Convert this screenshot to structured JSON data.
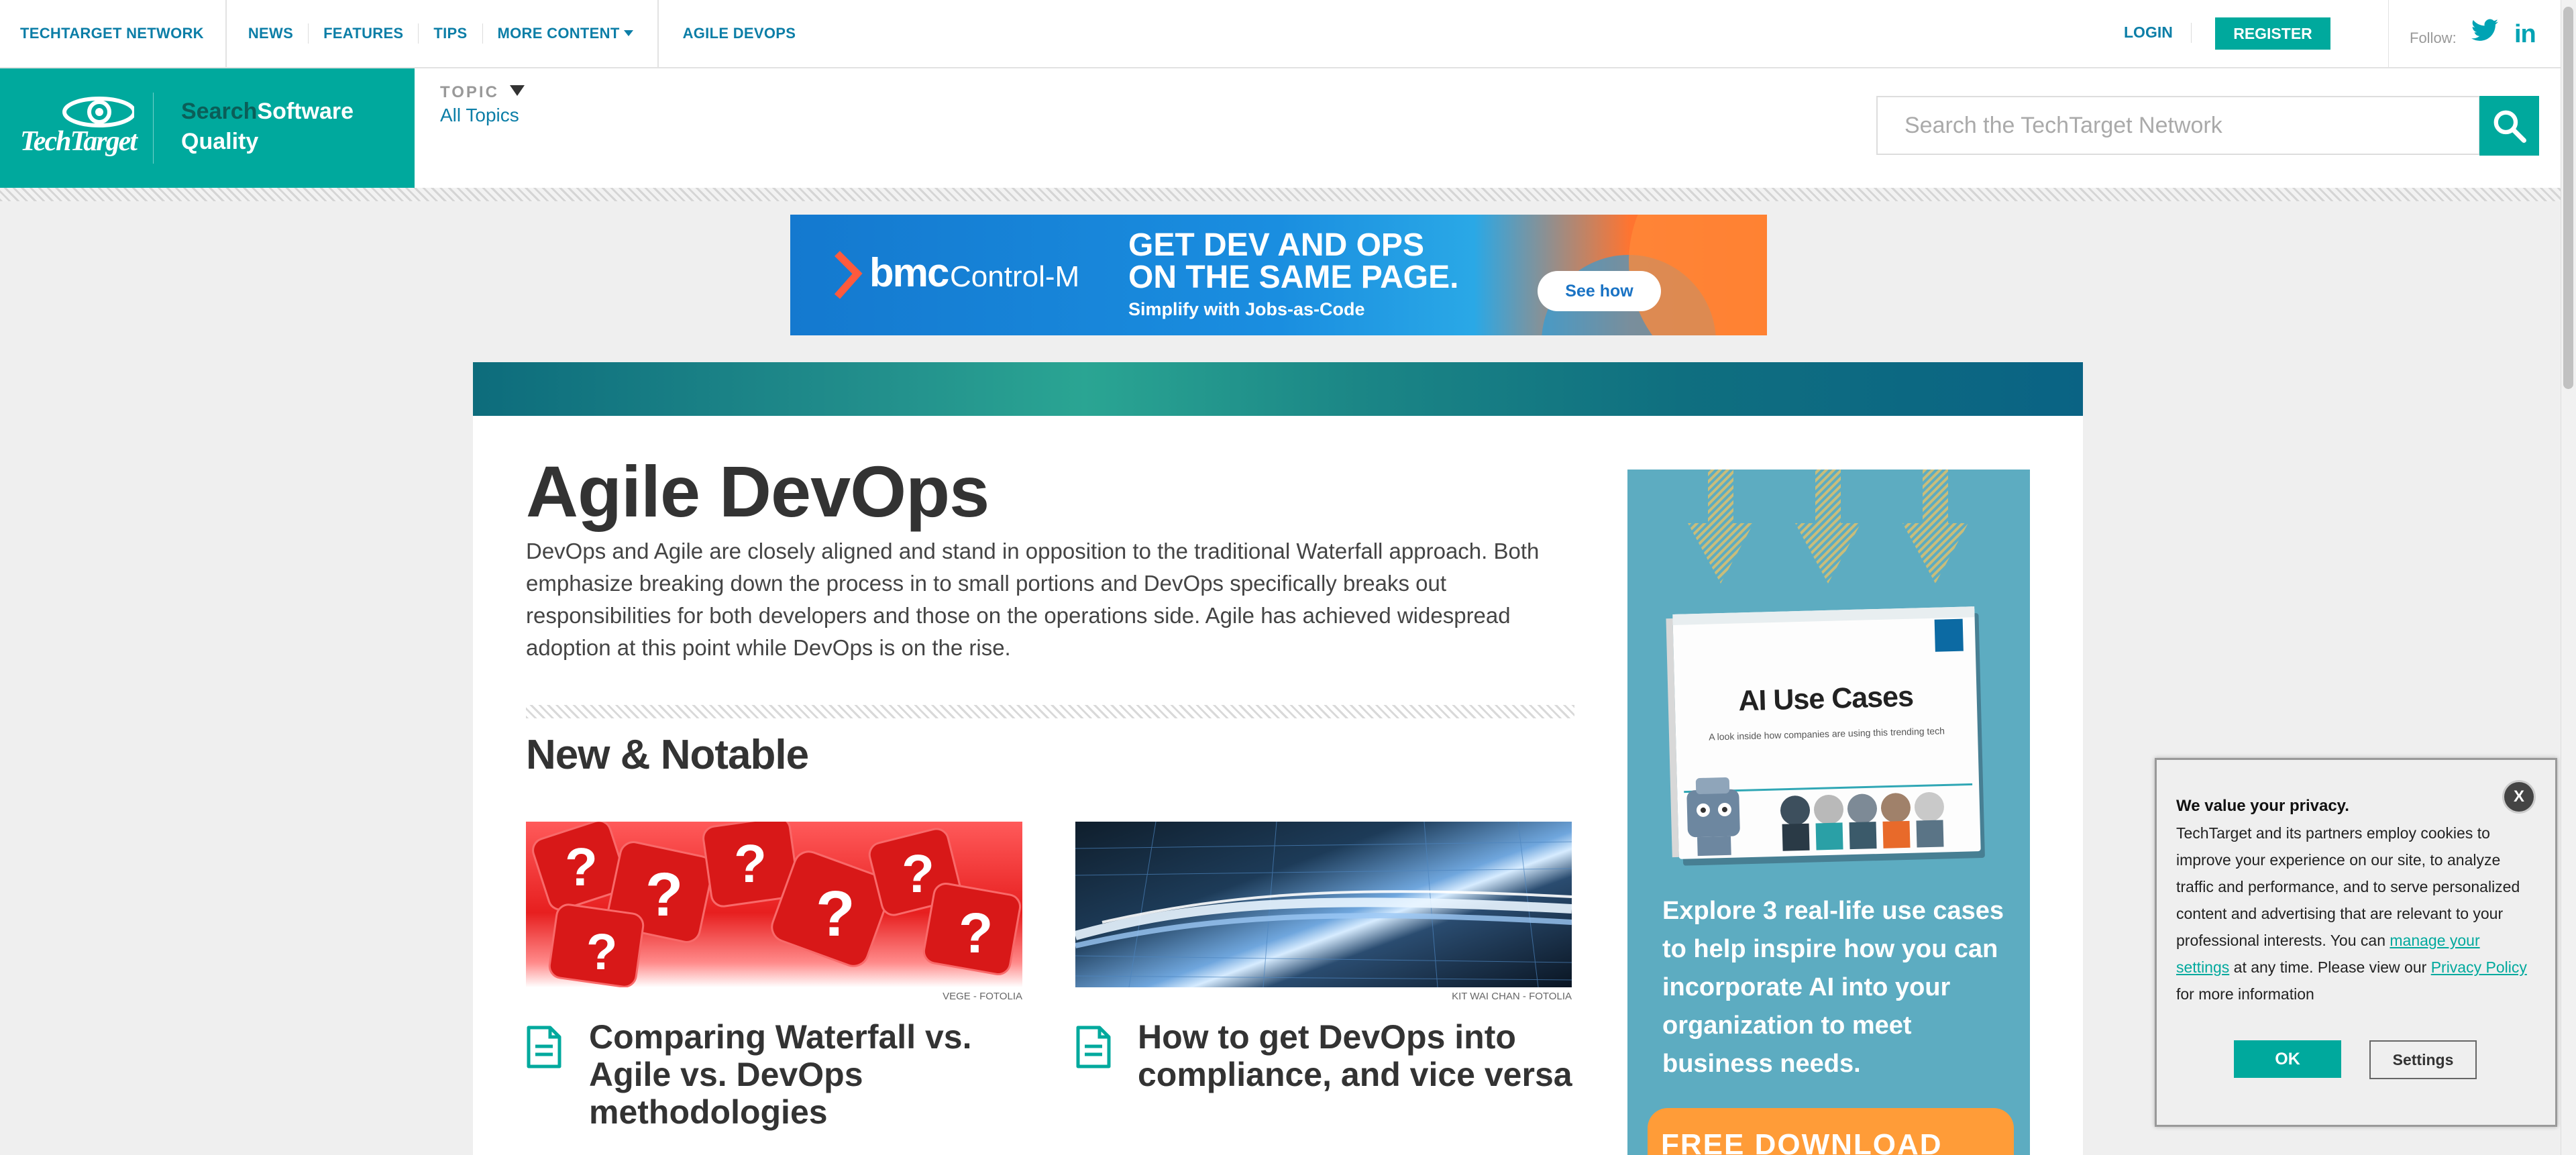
{
  "topnav": {
    "network": "TECHTARGET NETWORK",
    "links": [
      "NEWS",
      "FEATURES",
      "TIPS",
      "MORE CONTENT"
    ],
    "agile": "AGILE DEVOPS",
    "login": "LOGIN",
    "register": "REGISTER",
    "follow": "Follow:",
    "linkedin": "in"
  },
  "brand": {
    "logo_text": "TechTarget",
    "site_prefix": "Search",
    "site_name_1": "Software",
    "site_name_2": "Quality"
  },
  "topic": {
    "label": "TOPIC",
    "value": "All Topics"
  },
  "search": {
    "placeholder": "Search the TechTarget Network"
  },
  "banner_ad": {
    "brand": "bmc",
    "product": "Control-M",
    "headline_1": "GET DEV AND OPS",
    "headline_2": "ON THE SAME PAGE.",
    "subline": "Simplify with Jobs-as-Code",
    "button": "See how"
  },
  "main": {
    "title": "Agile DevOps",
    "description": "DevOps and Agile are closely aligned and stand in opposition to the traditional Waterfall approach. Both emphasize breaking down the process in to small portions and DevOps specifically breaks out responsibilities for both developers and those on the operations side. Agile has achieved widespread adoption at this point while DevOps is on the rise.",
    "section_title": "New & Notable",
    "articles": [
      {
        "credit": "VEGE - FOTOLIA",
        "title": "Comparing Waterfall vs. Agile vs. DevOps methodologies"
      },
      {
        "credit": "KIT WAI CHAN - FOTOLIA",
        "title": "How to get DevOps into compliance, and vice versa"
      }
    ]
  },
  "side_ad": {
    "book_title": "AI Use Cases",
    "book_subtitle": "A look inside how companies are using this trending tech",
    "text": "Explore 3 real-life use cases to help inspire how you can incorporate AI into your organization to meet business needs.",
    "cta": "FREE DOWNLOAD"
  },
  "privacy": {
    "close": "X",
    "heading": "We value your privacy.",
    "body_1": "TechTarget and its partners employ cookies to improve your experience on our site, to analyze traffic and performance, and to serve personalized content and advertising that are relevant to your professional interests. You can ",
    "link_1": "manage your settings",
    "body_2": " at any time. Please view our ",
    "link_2": "Privacy Policy ",
    "body_3": "for more information",
    "ok": "OK",
    "settings": "Settings"
  },
  "colors": {
    "accent": "#00a99d",
    "link": "#0c7ea7",
    "ad_blue": "#1a8ee0",
    "ad_orange": "#ff7430"
  }
}
